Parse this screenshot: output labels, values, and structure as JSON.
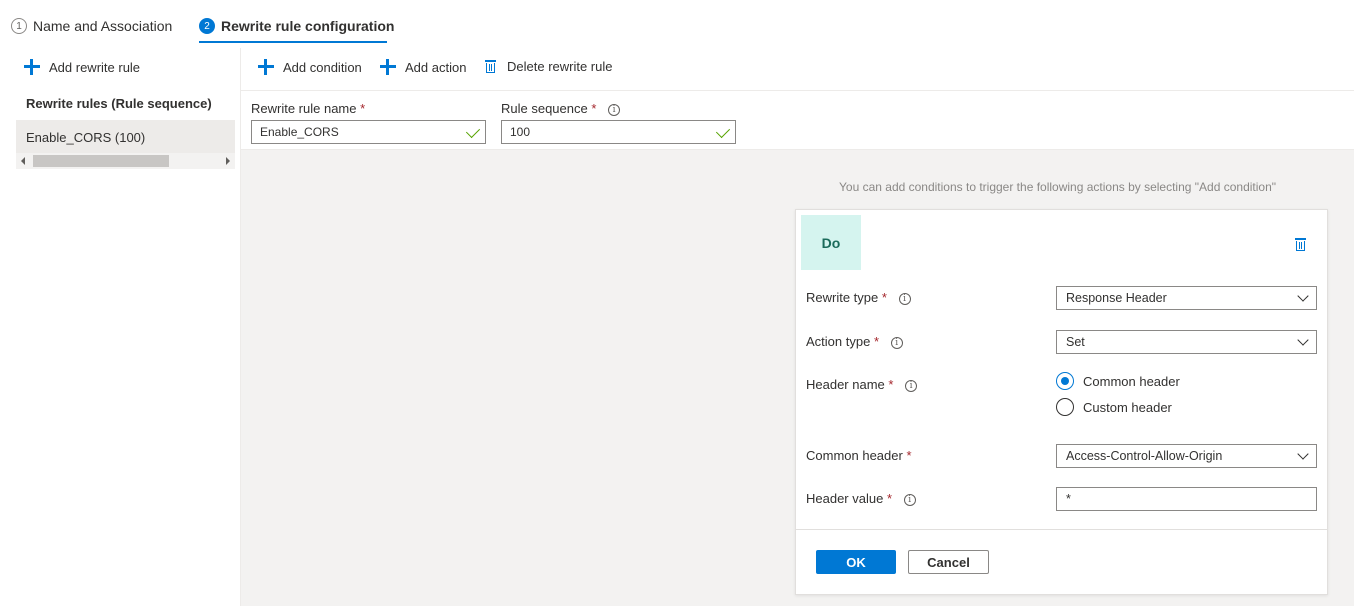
{
  "wizard": {
    "steps": [
      {
        "number": "1",
        "label": "Name and Association"
      },
      {
        "number": "2",
        "label": "Rewrite rule configuration"
      }
    ]
  },
  "left": {
    "add_rule_label": "Add rewrite rule",
    "rules_heading": "Rewrite rules (Rule sequence)",
    "rules": [
      "Enable_CORS (100)"
    ]
  },
  "toolbar": {
    "add_condition": "Add condition",
    "add_action": "Add action",
    "delete_rule": "Delete rewrite rule"
  },
  "fields": {
    "rule_name_label": "Rewrite rule name",
    "rule_name_value": "Enable_CORS",
    "rule_seq_label": "Rule sequence",
    "rule_seq_value": "100",
    "required_mark": "*"
  },
  "hint": "You can add conditions to trigger the following actions by selecting \"Add condition\"",
  "card": {
    "badge": "Do",
    "rewrite_type_label": "Rewrite type",
    "rewrite_type_value": "Response Header",
    "action_type_label": "Action type",
    "action_type_value": "Set",
    "header_name_label": "Header name",
    "radio_common": "Common header",
    "radio_custom": "Custom header",
    "common_header_label": "Common header",
    "common_header_value": "Access-Control-Allow-Origin",
    "header_value_label": "Header value",
    "header_value_value": "*",
    "ok": "OK",
    "cancel": "Cancel"
  },
  "icons": {
    "add": "plus-icon",
    "delete": "trash-icon",
    "info": "info-icon",
    "dropdown": "chevron-down-icon",
    "valid": "checkmark-icon"
  },
  "colors": {
    "accent": "#0078d4",
    "required": "#a4262c",
    "valid": "#57a300",
    "do_badge_bg": "#d5f4ef",
    "canvas_bg": "#f3f2f1"
  }
}
